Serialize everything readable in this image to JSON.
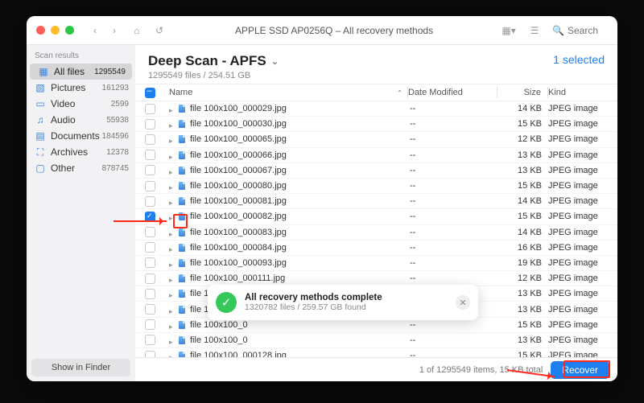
{
  "titlebar": {
    "title": "APPLE SSD AP0256Q – All recovery methods",
    "search_placeholder": "Search"
  },
  "sidebar": {
    "heading": "Scan results",
    "items": [
      {
        "icon": "grid",
        "label": "All files",
        "count": "1295549",
        "selected": true
      },
      {
        "icon": "pictures",
        "label": "Pictures",
        "count": "161293"
      },
      {
        "icon": "video",
        "label": "Video",
        "count": "2599"
      },
      {
        "icon": "audio",
        "label": "Audio",
        "count": "55938"
      },
      {
        "icon": "documents",
        "label": "Documents",
        "count": "184596"
      },
      {
        "icon": "archives",
        "label": "Archives",
        "count": "12378"
      },
      {
        "icon": "other",
        "label": "Other",
        "count": "878745"
      }
    ],
    "show_in_finder": "Show in Finder"
  },
  "header": {
    "title": "Deep Scan - APFS",
    "subtitle": "1295549 files / 254.51 GB",
    "selected_label": "1 selected"
  },
  "columns": {
    "name": "Name",
    "date": "Date Modified",
    "size": "Size",
    "kind": "Kind"
  },
  "rows": [
    {
      "name": "file 100x100_000029.jpg",
      "date": "--",
      "size": "14 KB",
      "kind": "JPEG image",
      "checked": false
    },
    {
      "name": "file 100x100_000030.jpg",
      "date": "--",
      "size": "15 KB",
      "kind": "JPEG image",
      "checked": false
    },
    {
      "name": "file 100x100_000065.jpg",
      "date": "--",
      "size": "12 KB",
      "kind": "JPEG image",
      "checked": false
    },
    {
      "name": "file 100x100_000066.jpg",
      "date": "--",
      "size": "13 KB",
      "kind": "JPEG image",
      "checked": false
    },
    {
      "name": "file 100x100_000067.jpg",
      "date": "--",
      "size": "13 KB",
      "kind": "JPEG image",
      "checked": false
    },
    {
      "name": "file 100x100_000080.jpg",
      "date": "--",
      "size": "15 KB",
      "kind": "JPEG image",
      "checked": false
    },
    {
      "name": "file 100x100_000081.jpg",
      "date": "--",
      "size": "14 KB",
      "kind": "JPEG image",
      "checked": false
    },
    {
      "name": "file 100x100_000082.jpg",
      "date": "--",
      "size": "15 KB",
      "kind": "JPEG image",
      "checked": true
    },
    {
      "name": "file 100x100_000083.jpg",
      "date": "--",
      "size": "14 KB",
      "kind": "JPEG image",
      "checked": false
    },
    {
      "name": "file 100x100_000084.jpg",
      "date": "--",
      "size": "16 KB",
      "kind": "JPEG image",
      "checked": false
    },
    {
      "name": "file 100x100_000093.jpg",
      "date": "--",
      "size": "19 KB",
      "kind": "JPEG image",
      "checked": false
    },
    {
      "name": "file 100x100_000111.jpg",
      "date": "--",
      "size": "12 KB",
      "kind": "JPEG image",
      "checked": false
    },
    {
      "name": "file 100x100_000112.jpg",
      "date": "--",
      "size": "13 KB",
      "kind": "JPEG image",
      "checked": false
    },
    {
      "name": "file 100x100_000",
      "date": "--",
      "size": "13 KB",
      "kind": "JPEG image",
      "checked": false
    },
    {
      "name": "file 100x100_0",
      "date": "--",
      "size": "15 KB",
      "kind": "JPEG image",
      "checked": false
    },
    {
      "name": "file 100x100_0",
      "date": "--",
      "size": "13 KB",
      "kind": "JPEG image",
      "checked": false
    },
    {
      "name": "file 100x100_000128.jpg",
      "date": "--",
      "size": "15 KB",
      "kind": "JPEG image",
      "checked": false
    }
  ],
  "toast": {
    "title": "All recovery methods complete",
    "subtitle": "1320782 files / 259.57 GB found"
  },
  "footer": {
    "status": "1 of 1295549 items, 15 KB total",
    "recover": "Recover"
  },
  "colors": {
    "accent": "#1e7ff0",
    "annotation": "#ff2a1a",
    "close": "#ff5f57",
    "min": "#febc2e",
    "max": "#28c840"
  }
}
